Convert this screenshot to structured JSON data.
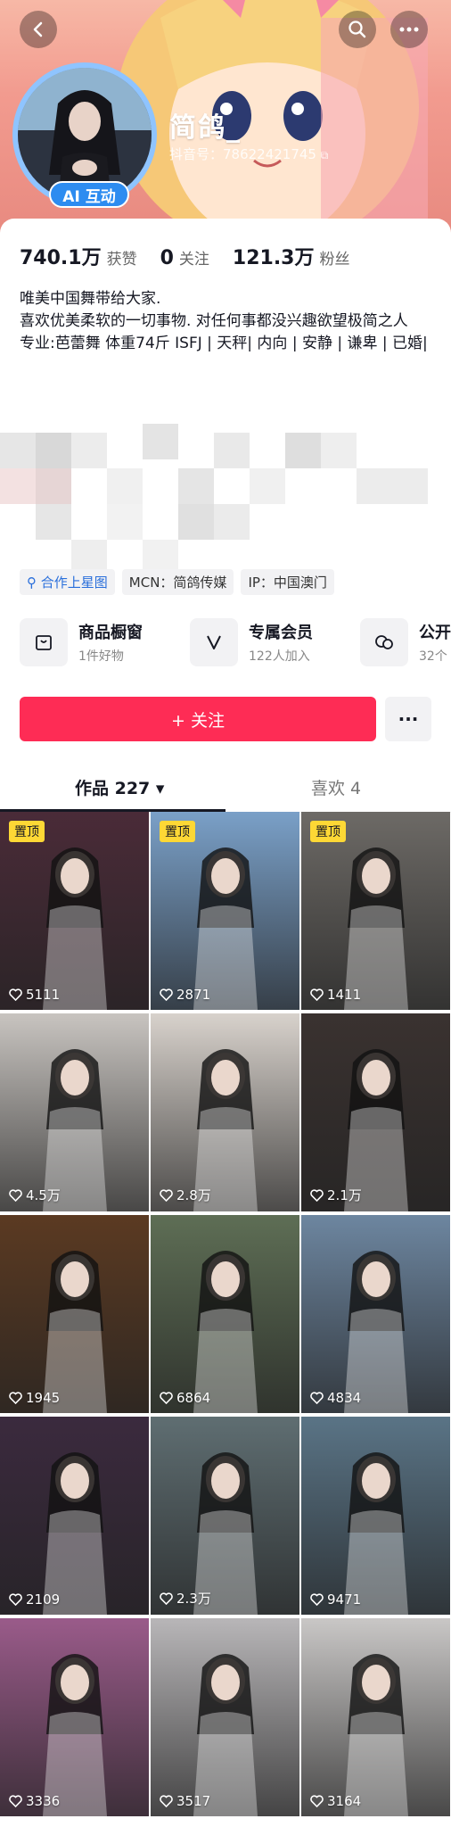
{
  "header": {
    "nickname": "简鸽_",
    "uid": "抖音号：78622421745",
    "ai_badge": "AI 互动"
  },
  "stats": [
    {
      "value": "740.1万",
      "label": "获赞"
    },
    {
      "value": "0",
      "label": "关注"
    },
    {
      "value": "121.3万",
      "label": "粉丝"
    }
  ],
  "bio": {
    "line1": "唯美中国舞带给大家.",
    "line2": "喜欢优美柔软的一切事物. 对任何事都没兴趣欲望极简之人",
    "line3": "专业:芭蕾舞 体重74斤 ISFJ | 天秤| 内向 | 安静 | 谦卑 | 已婚|"
  },
  "tags": [
    "合作上星图",
    "MCN：简鸽传媒",
    "IP：中国澳门"
  ],
  "features": [
    {
      "title": "商品橱窗",
      "sub": "1件好物",
      "icon": "bag-icon"
    },
    {
      "title": "专属会员",
      "sub": "122人加入",
      "icon": "v-icon"
    },
    {
      "title": "公开",
      "sub": "32个",
      "icon": "chat-icon"
    }
  ],
  "buttons": {
    "follow": "+ 关注",
    "more": "···"
  },
  "tabs": [
    {
      "label": "作品 227 ▾"
    },
    {
      "label": "喜欢 4"
    }
  ],
  "colors": {
    "accent": "#fe2c55",
    "pin": "#fdd835",
    "link": "#2a6fdb"
  },
  "videos": [
    {
      "likes": "5111",
      "pinned": true,
      "pin_label": "置顶",
      "bg": "#4a2b38"
    },
    {
      "likes": "2871",
      "pinned": true,
      "pin_label": "置顶",
      "bg": "#7aa0c8"
    },
    {
      "likes": "1411",
      "pinned": true,
      "pin_label": "置顶",
      "bg": "#6d6a66"
    },
    {
      "likes": "4.5万",
      "pinned": false,
      "bg": "#c8c4c0"
    },
    {
      "likes": "2.8万",
      "pinned": false,
      "bg": "#d8d2cc"
    },
    {
      "likes": "2.1万",
      "pinned": false,
      "bg": "#3a3230"
    },
    {
      "likes": "1945",
      "pinned": false,
      "bg": "#5b3a22"
    },
    {
      "likes": "6864",
      "pinned": false,
      "bg": "#5e6e55"
    },
    {
      "likes": "4834",
      "pinned": false,
      "bg": "#6d86a0"
    },
    {
      "likes": "2109",
      "pinned": false,
      "bg": "#3b2a3e"
    },
    {
      "likes": "2.3万",
      "pinned": false,
      "bg": "#5f6e72"
    },
    {
      "likes": "9471",
      "pinned": false,
      "bg": "#5a7486"
    },
    {
      "likes": "3336",
      "pinned": false,
      "bg": "#9a5b8a"
    },
    {
      "likes": "3517",
      "pinned": false,
      "bg": "#b8b6b8"
    },
    {
      "likes": "3164",
      "pinned": false,
      "bg": "#c9c7c6"
    }
  ]
}
